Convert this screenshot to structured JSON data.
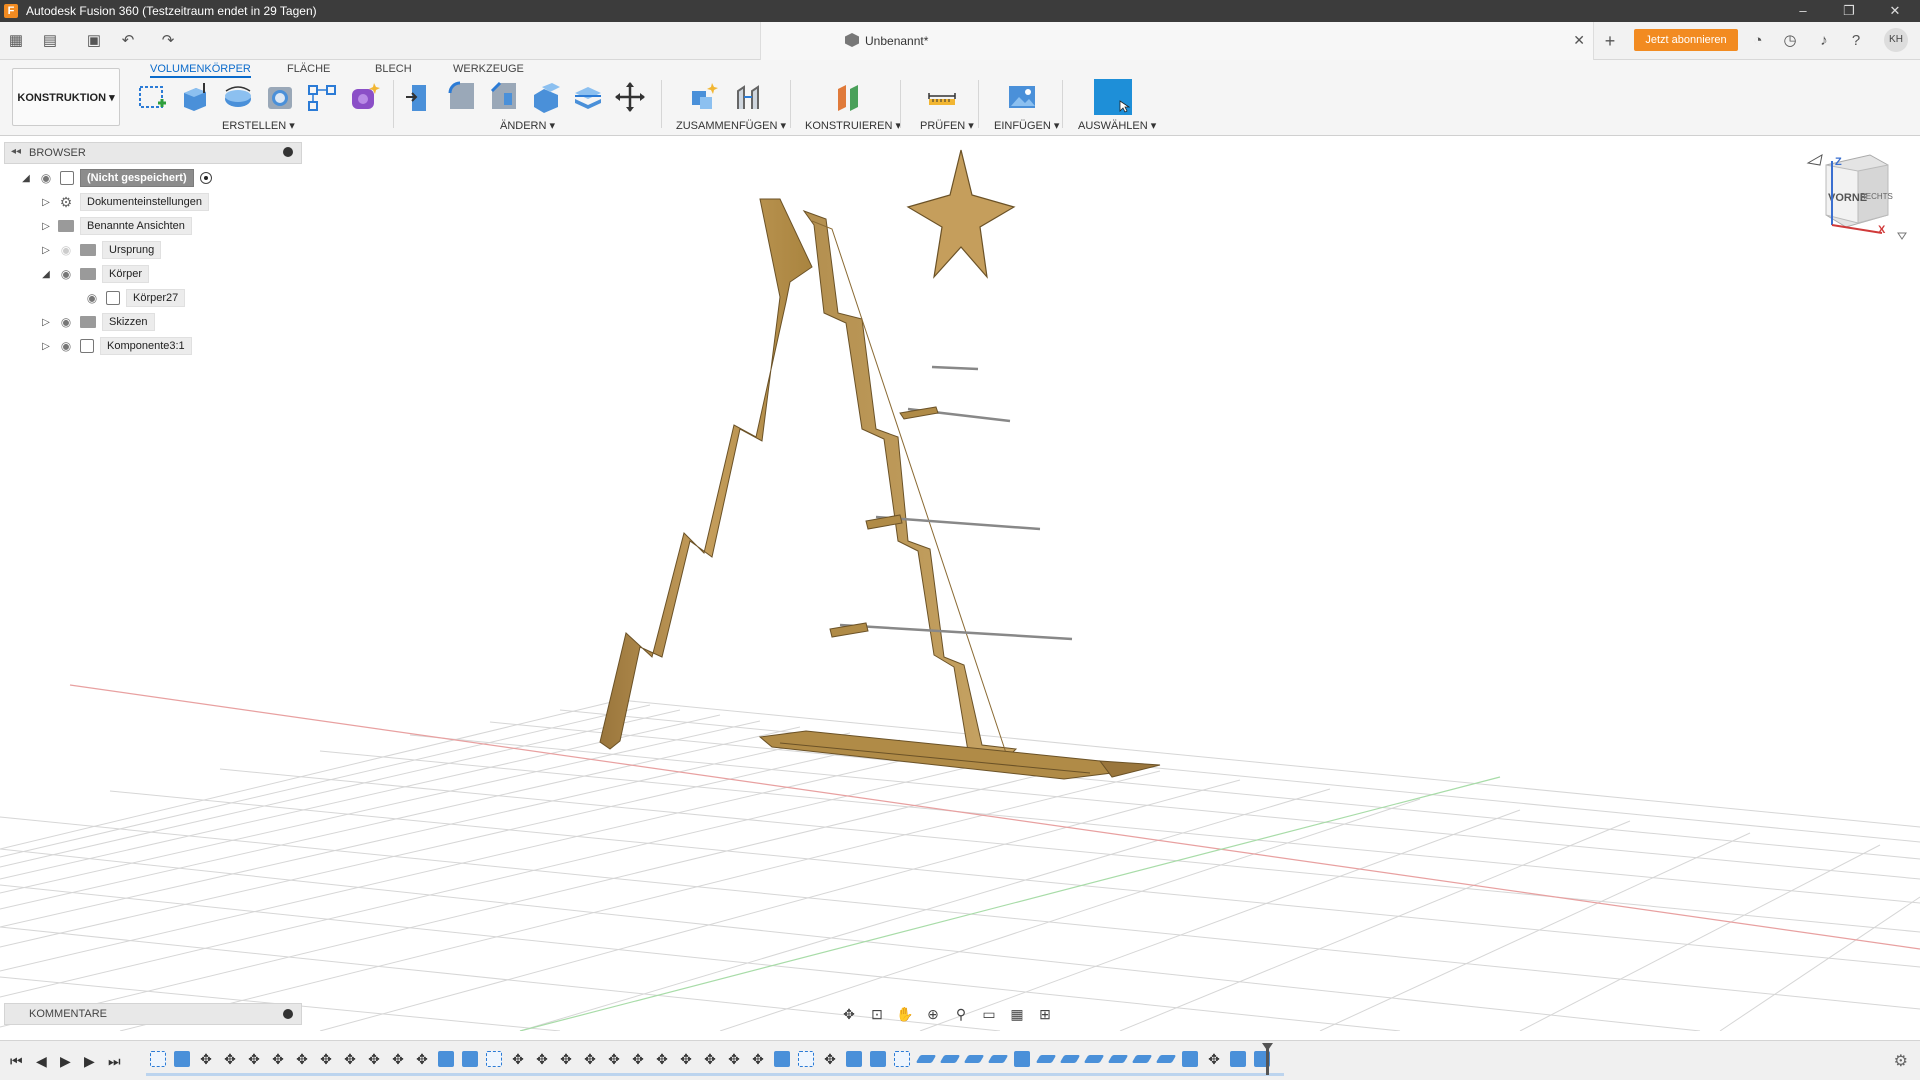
{
  "window": {
    "title": "Autodesk Fusion 360 (Testzeitraum endet in 29 Tagen)",
    "app_icon": "F",
    "controls": [
      "–",
      "❐",
      "✕"
    ]
  },
  "tabbar": {
    "document_title": "Unbenannt*",
    "close": "✕",
    "new_tab": "+",
    "subscribe_label": "Jetzt abonnieren",
    "avatar_initials": "KH"
  },
  "ribbon": {
    "workspace_label": "KONSTRUKTION ▾",
    "tabs": [
      "VOLUMENKÖRPER",
      "FLÄCHE",
      "BLECH",
      "WERKZEUGE"
    ],
    "groups": {
      "erstellen": "ERSTELLEN ▾",
      "aendern": "ÄNDERN ▾",
      "zusammenfuegen": "ZUSAMMENFÜGEN ▾",
      "konstruieren": "KONSTRUIEREN ▾",
      "pruefen": "PRÜFEN ▾",
      "einfuegen": "EINFÜGEN ▾",
      "auswaehlen": "AUSWÄHLEN ▾"
    }
  },
  "browser": {
    "header": "BROWSER",
    "items": [
      {
        "label": "(Nicht gespeichert)"
      },
      {
        "label": "Dokumenteinstellungen"
      },
      {
        "label": "Benannte Ansichten"
      },
      {
        "label": "Ursprung"
      },
      {
        "label": "Körper"
      },
      {
        "label": "Körper27"
      },
      {
        "label": "Skizzen"
      },
      {
        "label": "Komponente3:1"
      }
    ]
  },
  "viewcube": {
    "front": "VORNE",
    "right": "RECHTS",
    "axis_z": "Z",
    "axis_x": "X"
  },
  "comments": {
    "header": "KOMMENTARE"
  },
  "colors": {
    "accent": "#0b6bcb",
    "subscribe": "#f28b21",
    "wood": "#b8924f",
    "wood_dark": "#8a6a33"
  }
}
